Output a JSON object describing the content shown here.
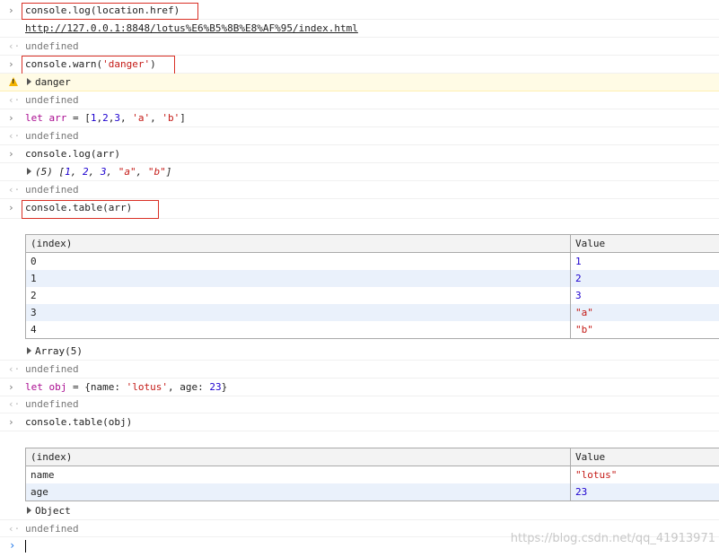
{
  "prompt_glyph": "›",
  "return_glyph": "‹·",
  "lines": {
    "l1": "console.log(location.href)",
    "l2_url": "http://127.0.0.1:8848/lotus%E6%B5%8B%E8%AF%95/index.html",
    "undefined": "undefined",
    "l4": "console.warn('danger')",
    "warn_text": "danger",
    "l7_let": "let",
    "l7_arr": "arr",
    "l7_eq": " = [",
    "l7_n1": "1",
    "l7_n2": "2",
    "l7_n3": "3",
    "l7_sa": "'a'",
    "l7_sb": "'b'",
    "l9": "console.log(arr)",
    "l10_len": "(5) [",
    "l12": "console.table(arr)",
    "array_summary": "Array(5)",
    "l16_let": "let",
    "l16_obj": "obj",
    "l16_rest1": " = {name: ",
    "l16_str": "'lotus'",
    "l16_rest2": ", age: ",
    "l16_num": "23",
    "l16_end": "}",
    "l18": "console.table(obj)",
    "object_summary": "Object"
  },
  "table_arr": {
    "headers": [
      "(index)",
      "Value"
    ],
    "rows": [
      {
        "index": "0",
        "value": "1",
        "type": "num"
      },
      {
        "index": "1",
        "value": "2",
        "type": "num"
      },
      {
        "index": "2",
        "value": "3",
        "type": "num"
      },
      {
        "index": "3",
        "value": "\"a\"",
        "type": "str"
      },
      {
        "index": "4",
        "value": "\"b\"",
        "type": "str"
      }
    ]
  },
  "table_obj": {
    "headers": [
      "(index)",
      "Value"
    ],
    "rows": [
      {
        "index": "name",
        "value": "\"lotus\"",
        "type": "str"
      },
      {
        "index": "age",
        "value": "23",
        "type": "num"
      }
    ]
  },
  "watermark": "https://blog.csdn.net/qq_41913971",
  "colors": {
    "highlight_box": "#d93025",
    "warning_bg": "#fffbe5",
    "warning_icon": "#f4b400",
    "number": "#1c00cf",
    "string": "#c41a16",
    "keyword": "#aa0d91",
    "alt_row": "#eaf1fb",
    "prompt_caret": "#1a73e8"
  }
}
